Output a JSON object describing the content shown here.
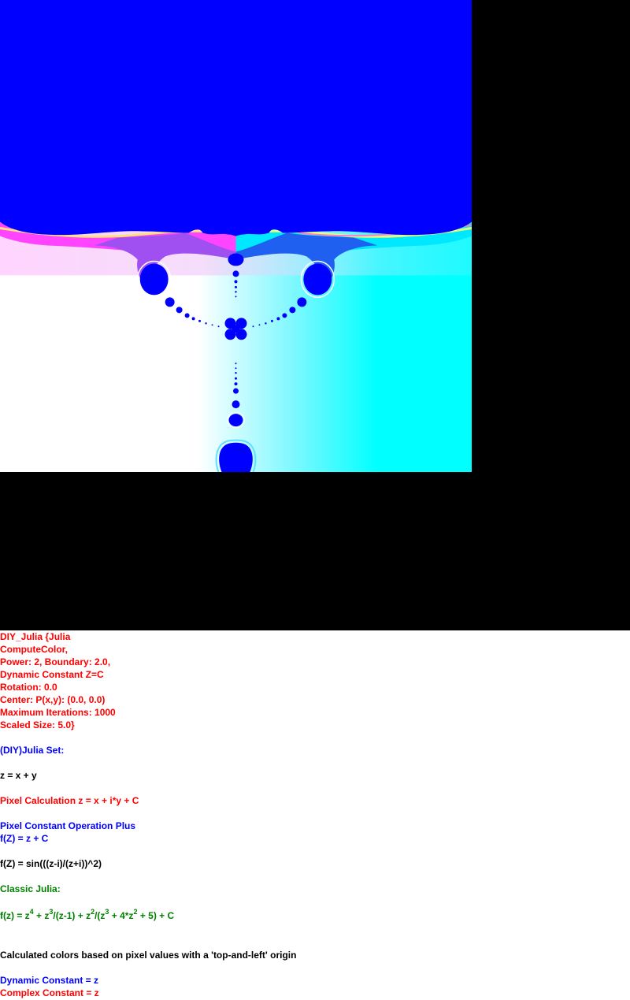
{
  "colors": {
    "canvas_background": "#000000",
    "fractal_interior": "#0000ff",
    "gradient_left": "#ffffff",
    "gradient_right": "#00ffff",
    "band_magenta": "#ff33ff",
    "band_violet": "#a050f0",
    "band_cyan": "#00e5ff",
    "text_red": "#ff0000",
    "text_blue": "#0000ff",
    "text_black": "#000000",
    "text_green": "#008000"
  },
  "info": {
    "line1": "DIY_Julia {Julia",
    "line2": "ComputeColor,",
    "line3": "Power: 2, Boundary: 2.0,",
    "line4": "Dynamic Constant Z=C",
    "line5": "Rotation: 0.0",
    "line6": "Center: P(x,y): (0.0, 0.0)",
    "line7": "Maximum Iterations: 1000",
    "line8": "Scaled Size: 5.0}",
    "set_title": "(DIY)Julia Set:",
    "z_def": "z = x + y",
    "pixel_calc": "Pixel Calculation z = x + i*y + C",
    "pixel_const_op": "Pixel Constant Operation Plus",
    "fz_plus": "f(Z) = z + C",
    "fz_sin": "f(Z) = sin(((z-i)/(z+i))^2)",
    "classic_title": "Classic Julia:",
    "classic_formula": {
      "p1": "f(z) = z",
      "e1": "4",
      "p2": " + z",
      "e2": "3",
      "p3": "/(z-1) + z",
      "e3": "2",
      "p4": "/(z",
      "e4": "3",
      "p5": " + 4*z",
      "e5": "2",
      "p6": " + 5) + C"
    },
    "calc_colors": "Calculated colors based on pixel values with a 'top-and-left' origin",
    "dynamic_const": "Dynamic Constant = z",
    "complex_const": "Complex Constant = z"
  }
}
